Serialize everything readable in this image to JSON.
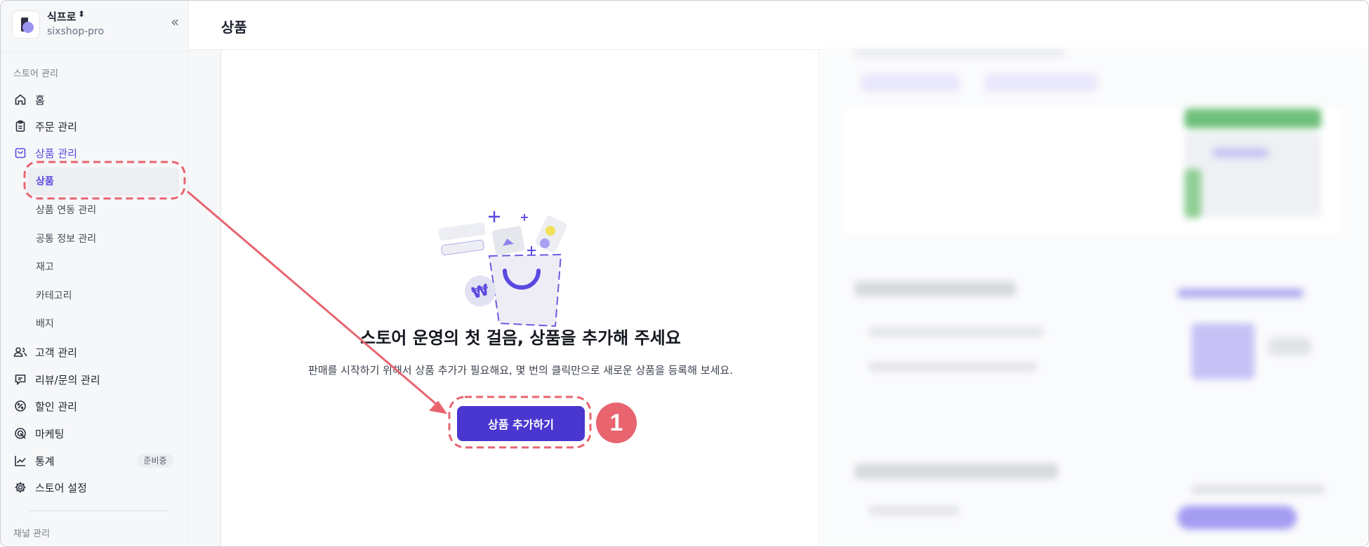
{
  "store": {
    "name": "식프로",
    "caret": "⬍",
    "domain": "sixshop-pro"
  },
  "header": {
    "title": "상품"
  },
  "sidebar": {
    "store_section": "스토어 관리",
    "channel_section": "채널 관리",
    "items": [
      {
        "label": "홈",
        "icon": "home-icon"
      },
      {
        "label": "주문 관리",
        "icon": "clipboard-icon"
      },
      {
        "label": "상품 관리",
        "icon": "shopping-bag-icon"
      },
      {
        "label": "고객 관리",
        "icon": "users-icon"
      },
      {
        "label": "리뷰/문의 관리",
        "icon": "message-icon"
      },
      {
        "label": "할인 관리",
        "icon": "percent-icon"
      },
      {
        "label": "마케팅",
        "icon": "target-icon"
      },
      {
        "label": "통계",
        "icon": "chart-line-icon",
        "badge": "준비중"
      },
      {
        "label": "스토어 설정",
        "icon": "gear-icon"
      }
    ],
    "product_sub": [
      {
        "label": "상품"
      },
      {
        "label": "상품 연동 관리"
      },
      {
        "label": "공통 정보 관리"
      },
      {
        "label": "재고"
      },
      {
        "label": "카테고리"
      },
      {
        "label": "배지"
      }
    ]
  },
  "main": {
    "empty_title": "스토어 운영의 첫 걸음, 상품을 추가해 주세요",
    "empty_desc": "판매를 시작하기 위해서 상품 추가가 필요해요, 몇 번의 클릭만으로 새로운 상품을 등록해 보세요.",
    "add_button": "상품 추가하기",
    "illustration_currency": "₩"
  },
  "annotation": {
    "step_number": "1"
  },
  "colors": {
    "accent": "#4a37cf",
    "active_nav": "#5a48e0",
    "annotation": "#e8646f"
  }
}
